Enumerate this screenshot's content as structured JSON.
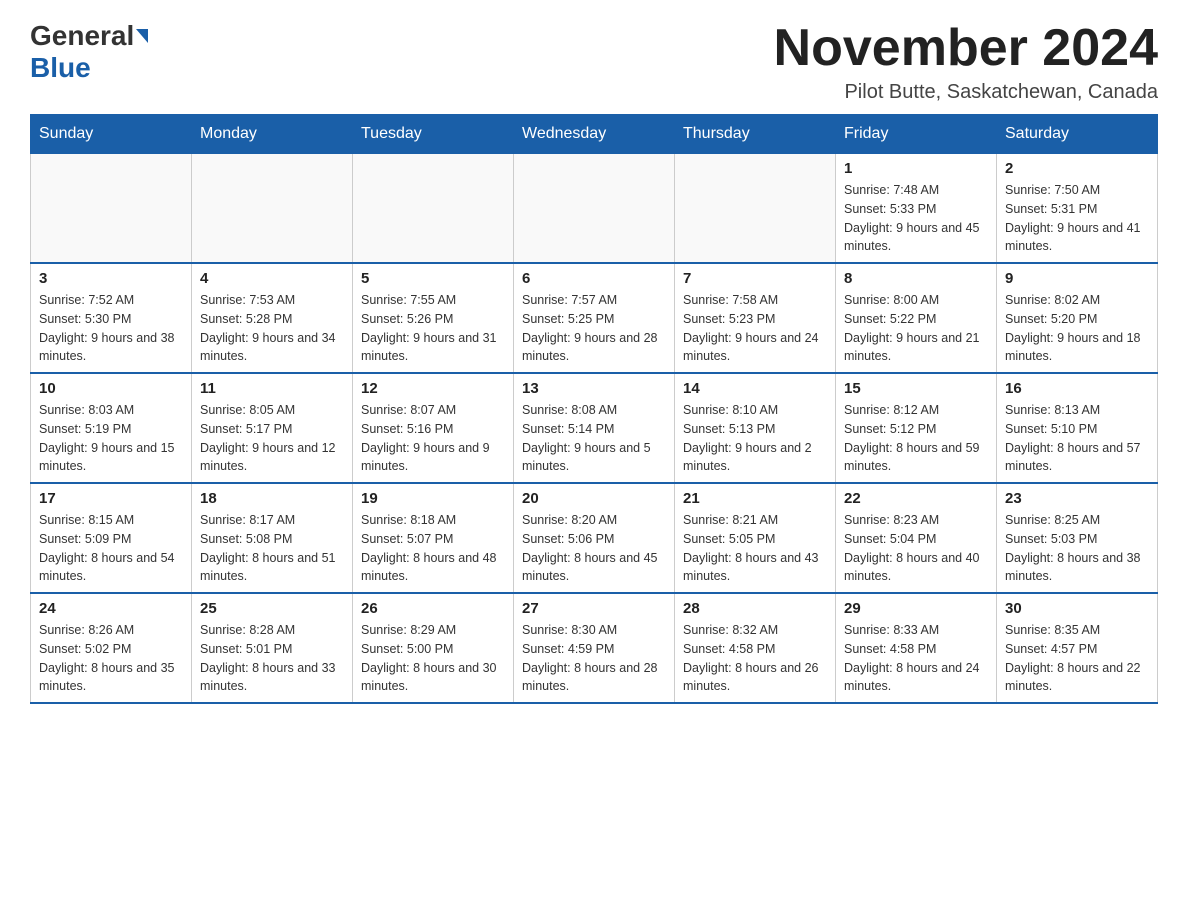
{
  "header": {
    "logo_text": "General",
    "logo_blue": "Blue",
    "month_title": "November 2024",
    "location": "Pilot Butte, Saskatchewan, Canada"
  },
  "days_of_week": [
    "Sunday",
    "Monday",
    "Tuesday",
    "Wednesday",
    "Thursday",
    "Friday",
    "Saturday"
  ],
  "weeks": [
    {
      "days": [
        {
          "number": "",
          "info": ""
        },
        {
          "number": "",
          "info": ""
        },
        {
          "number": "",
          "info": ""
        },
        {
          "number": "",
          "info": ""
        },
        {
          "number": "",
          "info": ""
        },
        {
          "number": "1",
          "info": "Sunrise: 7:48 AM\nSunset: 5:33 PM\nDaylight: 9 hours and 45 minutes."
        },
        {
          "number": "2",
          "info": "Sunrise: 7:50 AM\nSunset: 5:31 PM\nDaylight: 9 hours and 41 minutes."
        }
      ]
    },
    {
      "days": [
        {
          "number": "3",
          "info": "Sunrise: 7:52 AM\nSunset: 5:30 PM\nDaylight: 9 hours and 38 minutes."
        },
        {
          "number": "4",
          "info": "Sunrise: 7:53 AM\nSunset: 5:28 PM\nDaylight: 9 hours and 34 minutes."
        },
        {
          "number": "5",
          "info": "Sunrise: 7:55 AM\nSunset: 5:26 PM\nDaylight: 9 hours and 31 minutes."
        },
        {
          "number": "6",
          "info": "Sunrise: 7:57 AM\nSunset: 5:25 PM\nDaylight: 9 hours and 28 minutes."
        },
        {
          "number": "7",
          "info": "Sunrise: 7:58 AM\nSunset: 5:23 PM\nDaylight: 9 hours and 24 minutes."
        },
        {
          "number": "8",
          "info": "Sunrise: 8:00 AM\nSunset: 5:22 PM\nDaylight: 9 hours and 21 minutes."
        },
        {
          "number": "9",
          "info": "Sunrise: 8:02 AM\nSunset: 5:20 PM\nDaylight: 9 hours and 18 minutes."
        }
      ]
    },
    {
      "days": [
        {
          "number": "10",
          "info": "Sunrise: 8:03 AM\nSunset: 5:19 PM\nDaylight: 9 hours and 15 minutes."
        },
        {
          "number": "11",
          "info": "Sunrise: 8:05 AM\nSunset: 5:17 PM\nDaylight: 9 hours and 12 minutes."
        },
        {
          "number": "12",
          "info": "Sunrise: 8:07 AM\nSunset: 5:16 PM\nDaylight: 9 hours and 9 minutes."
        },
        {
          "number": "13",
          "info": "Sunrise: 8:08 AM\nSunset: 5:14 PM\nDaylight: 9 hours and 5 minutes."
        },
        {
          "number": "14",
          "info": "Sunrise: 8:10 AM\nSunset: 5:13 PM\nDaylight: 9 hours and 2 minutes."
        },
        {
          "number": "15",
          "info": "Sunrise: 8:12 AM\nSunset: 5:12 PM\nDaylight: 8 hours and 59 minutes."
        },
        {
          "number": "16",
          "info": "Sunrise: 8:13 AM\nSunset: 5:10 PM\nDaylight: 8 hours and 57 minutes."
        }
      ]
    },
    {
      "days": [
        {
          "number": "17",
          "info": "Sunrise: 8:15 AM\nSunset: 5:09 PM\nDaylight: 8 hours and 54 minutes."
        },
        {
          "number": "18",
          "info": "Sunrise: 8:17 AM\nSunset: 5:08 PM\nDaylight: 8 hours and 51 minutes."
        },
        {
          "number": "19",
          "info": "Sunrise: 8:18 AM\nSunset: 5:07 PM\nDaylight: 8 hours and 48 minutes."
        },
        {
          "number": "20",
          "info": "Sunrise: 8:20 AM\nSunset: 5:06 PM\nDaylight: 8 hours and 45 minutes."
        },
        {
          "number": "21",
          "info": "Sunrise: 8:21 AM\nSunset: 5:05 PM\nDaylight: 8 hours and 43 minutes."
        },
        {
          "number": "22",
          "info": "Sunrise: 8:23 AM\nSunset: 5:04 PM\nDaylight: 8 hours and 40 minutes."
        },
        {
          "number": "23",
          "info": "Sunrise: 8:25 AM\nSunset: 5:03 PM\nDaylight: 8 hours and 38 minutes."
        }
      ]
    },
    {
      "days": [
        {
          "number": "24",
          "info": "Sunrise: 8:26 AM\nSunset: 5:02 PM\nDaylight: 8 hours and 35 minutes."
        },
        {
          "number": "25",
          "info": "Sunrise: 8:28 AM\nSunset: 5:01 PM\nDaylight: 8 hours and 33 minutes."
        },
        {
          "number": "26",
          "info": "Sunrise: 8:29 AM\nSunset: 5:00 PM\nDaylight: 8 hours and 30 minutes."
        },
        {
          "number": "27",
          "info": "Sunrise: 8:30 AM\nSunset: 4:59 PM\nDaylight: 8 hours and 28 minutes."
        },
        {
          "number": "28",
          "info": "Sunrise: 8:32 AM\nSunset: 4:58 PM\nDaylight: 8 hours and 26 minutes."
        },
        {
          "number": "29",
          "info": "Sunrise: 8:33 AM\nSunset: 4:58 PM\nDaylight: 8 hours and 24 minutes."
        },
        {
          "number": "30",
          "info": "Sunrise: 8:35 AM\nSunset: 4:57 PM\nDaylight: 8 hours and 22 minutes."
        }
      ]
    }
  ]
}
